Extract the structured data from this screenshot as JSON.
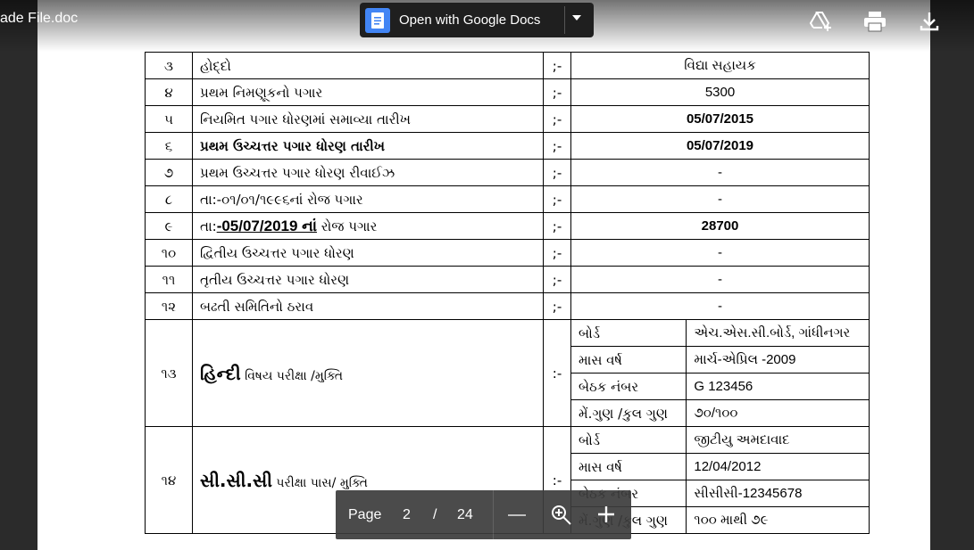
{
  "header": {
    "filename": "ade File.doc",
    "open_with": "Open with Google Docs"
  },
  "icons": {
    "add_to_drive": "add-to-drive-icon",
    "print": "print-icon",
    "download": "download-icon",
    "docs": "google-docs-icon"
  },
  "rows": [
    {
      "num": "૩",
      "label": "હોદ્દો",
      "sep": ";-",
      "value": "વિદ્યા સહાયક"
    },
    {
      "num": "૪",
      "label": "પ્રથમ નિમણૂકનો પગાર",
      "sep": ";-",
      "value": "5300"
    },
    {
      "num": "૫",
      "label": "નિયમિત પગાર ધોરણમાં સમાવ્યા તારીખ",
      "sep": ";-",
      "value": "05/07/2015"
    },
    {
      "num": "૬",
      "label": "પ્રથમ ઉચ્ચત્તર પગાર ધોરણ તારીખ",
      "sep": ";-",
      "value": "05/07/2019"
    },
    {
      "num": "૭",
      "label": "પ્રથમ ઉચ્ચત્તર પગાર ધોરણ રીવાઈઝ",
      "sep": ";-",
      "value": "-"
    },
    {
      "num": "૮",
      "label": "તા:-૦૧/૦૧/૧૯૯૬નાં રોજ પગાર",
      "sep": ";-",
      "value": "-"
    },
    {
      "num": "૯",
      "label_pre": "તા:",
      "label_date": "-05/07/2019 નાં",
      "label_post": " રોજ પગાર",
      "sep": ";-",
      "value": "28700"
    },
    {
      "num": "૧૦",
      "label": "દ્વિતીય ઉચ્ચત્તર પગાર ધોરણ",
      "sep": ";-",
      "value": "-"
    },
    {
      "num": "૧૧",
      "label": "તૃતીય ઉચ્ચત્તર પગાર ધોરણ",
      "sep": ";-",
      "value": "-"
    },
    {
      "num": "૧૨",
      "label": "બઢતી સમિતિનો ઠરાવ",
      "sep": ";-",
      "value": "-"
    }
  ],
  "exam13": {
    "num": "૧૩",
    "subject": "હિન્દી",
    "suffix": " વિષય પરીક્ષા /મુક્તિ",
    "sep": ":-",
    "details": [
      {
        "key": "બોર્ડ",
        "value": "એચ.એસ.સી.બોર્ડ, ગાંધીનગર"
      },
      {
        "key": "માસ વર્ષ",
        "value": "માર્ચ-એપ્રિલ -2009"
      },
      {
        "key": "બેઠક નંબર",
        "value": "G 123456"
      },
      {
        "key": "મેં.ગુણ /કુલ ગુણ",
        "value": "૭૦/૧૦૦"
      }
    ]
  },
  "exam14": {
    "num": "૧૪",
    "subject": "સી.સી.સી",
    "suffix": " પરીક્ષા પાસ/ મુક્તિ",
    "sep": ":-",
    "details": [
      {
        "key": "બોર્ડ",
        "value": "જીટીયુ અમદાવાદ"
      },
      {
        "key": "માસ વર્ષ",
        "value": "12/04/2012"
      },
      {
        "key": "બેઠક નંબર",
        "value": "સીસીસી-12345678"
      },
      {
        "key": "મેં.ગુણ /કુલ ગુણ",
        "value": "૧૦૦ માથી ૭૯"
      }
    ]
  },
  "pager": {
    "label": "Page",
    "current": "2",
    "slash": "/",
    "total": "24"
  }
}
